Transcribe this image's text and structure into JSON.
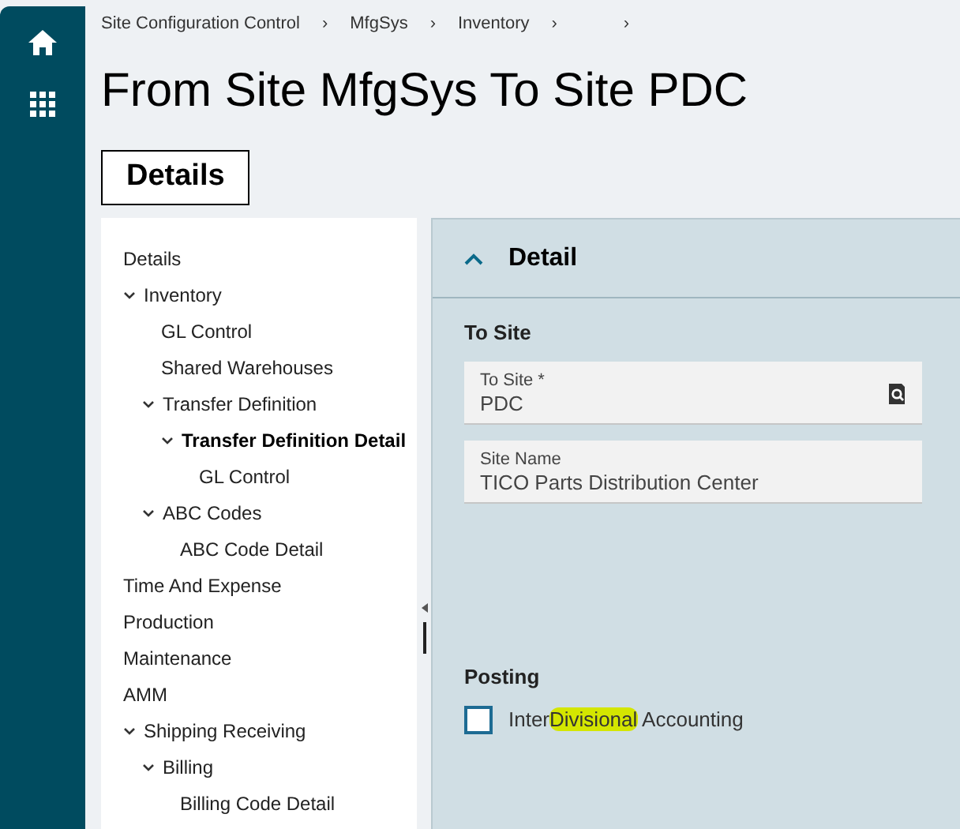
{
  "breadcrumb": [
    {
      "label": "Site Configuration Control",
      "separator": "›"
    },
    {
      "label": "MfgSys",
      "separator": "›"
    },
    {
      "label": "Inventory",
      "separator": "›"
    },
    {
      "separator": "›"
    }
  ],
  "title": "From Site MfgSys To Site PDC",
  "tabs": [
    {
      "label": "Details",
      "selected": true
    }
  ],
  "tree": [
    {
      "label": "Details",
      "selected": false
    },
    {
      "label": "Inventory",
      "selected": false,
      "expanded": true,
      "children": [
        {
          "label": "GL Control",
          "selected": false
        },
        {
          "label": "Shared Warehouses",
          "selected": false
        },
        {
          "label": "Transfer Definition",
          "selected": false,
          "expanded": true,
          "children": [
            {
              "label": "Transfer Definition Detail",
              "selected": true,
              "expanded": true,
              "children": [
                {
                  "label": "GL Control",
                  "selected": false
                }
              ]
            }
          ]
        },
        {
          "label": "ABC Codes",
          "selected": false,
          "expanded": true,
          "children": [
            {
              "label": "ABC Code Detail",
              "selected": false
            }
          ]
        }
      ]
    },
    {
      "label": "Time And Expense",
      "selected": false
    },
    {
      "label": "Production",
      "selected": false
    },
    {
      "label": "Maintenance",
      "selected": false
    },
    {
      "label": "AMM",
      "selected": false
    },
    {
      "label": "Shipping Receiving",
      "selected": false,
      "expanded": true,
      "children": [
        {
          "label": "Billing",
          "selected": false,
          "expanded": true,
          "children": [
            {
              "label": "Billing Code Detail",
              "selected": false
            }
          ]
        }
      ]
    }
  ],
  "panel": {
    "title": "Detail",
    "expanded": true,
    "sections": [
      {
        "heading": "To Site",
        "fields": [
          {
            "label": "To Site *",
            "value": "PDC",
            "search": true
          },
          {
            "label": "Site Name",
            "value": "TICO Parts Distribution Center",
            "search": false
          }
        ]
      },
      {
        "heading": "Posting",
        "checkboxes": [
          {
            "label_parts": [
              {
                "text": "Inter",
                "highlighted": false
              },
              {
                "text": "Divisional",
                "highlighted": true
              },
              {
                "text": " Accounting",
                "highlighted": false
              }
            ],
            "checked": false
          }
        ]
      }
    ]
  }
}
